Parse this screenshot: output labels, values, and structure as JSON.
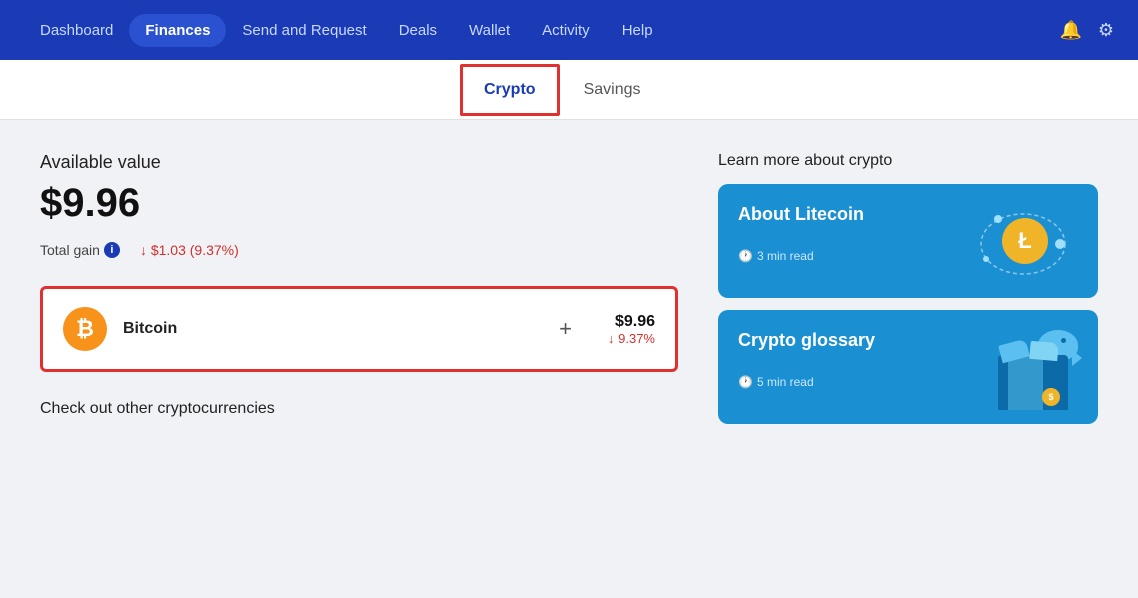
{
  "nav": {
    "items": [
      {
        "id": "dashboard",
        "label": "Dashboard",
        "active": false
      },
      {
        "id": "finances",
        "label": "Finances",
        "active": true
      },
      {
        "id": "send-request",
        "label": "Send and Request",
        "active": false
      },
      {
        "id": "deals",
        "label": "Deals",
        "active": false
      },
      {
        "id": "wallet",
        "label": "Wallet",
        "active": false
      },
      {
        "id": "activity",
        "label": "Activity",
        "active": false
      },
      {
        "id": "help",
        "label": "Help",
        "active": false
      }
    ]
  },
  "tabs": [
    {
      "id": "crypto",
      "label": "Crypto",
      "active": true
    },
    {
      "id": "savings",
      "label": "Savings",
      "active": false
    }
  ],
  "main": {
    "available_label": "Available value",
    "available_value": "$9.96",
    "total_gain_label": "Total gain",
    "total_gain_value": "↓ $1.03 (9.37%)",
    "crypto_card": {
      "name": "Bitcoin",
      "plus": "+",
      "usd_value": "$9.96",
      "pct_change": "↓ 9.37%"
    },
    "check_other": "Check out other cryptocurrencies"
  },
  "sidebar": {
    "learn_title": "Learn more about crypto",
    "cards": [
      {
        "id": "litecoin",
        "title": "About Litecoin",
        "time_label": "3 min read"
      },
      {
        "id": "glossary",
        "title": "Crypto glossary",
        "time_label": "5 min read"
      }
    ]
  }
}
